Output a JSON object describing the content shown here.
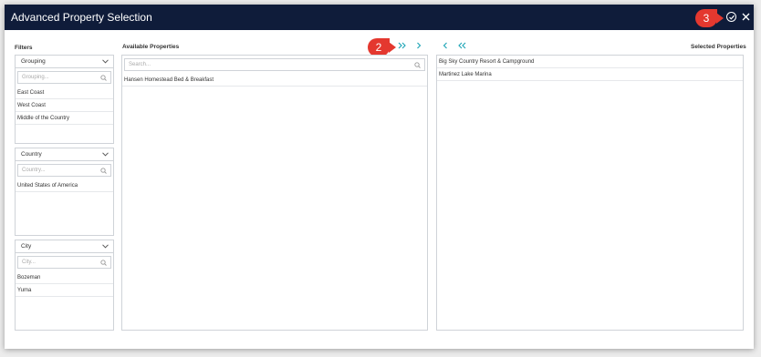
{
  "window": {
    "title": "Advanced Property Selection",
    "callout_confirm": "3"
  },
  "filters": {
    "label": "Filters",
    "grouping": {
      "header": "Grouping",
      "placeholder": "Grouping...",
      "items": [
        "East Coast",
        "West Coast",
        "Middle of the Country"
      ]
    },
    "country": {
      "header": "Country",
      "placeholder": "Country...",
      "items": [
        "United States of America"
      ]
    },
    "city": {
      "header": "City",
      "placeholder": "City...",
      "items": [
        "Bozeman",
        "Yuma"
      ]
    }
  },
  "available": {
    "label": "Available Properties",
    "search_placeholder": "Search...",
    "items": [
      "Hansen Homestead Bed & Breakfast"
    ],
    "callout_move": "2"
  },
  "selected": {
    "label": "Selected Properties",
    "items": [
      "Big Sky Country Resort & Campground",
      "Martinez Lake Marina"
    ]
  },
  "colors": {
    "titlebar": "#0f1c3a",
    "accent_arrows": "#1aa3b5",
    "callout": "#e4382f"
  },
  "icons": {
    "move_all_right": "double-chevron-right-icon",
    "move_right": "chevron-right-icon",
    "move_left": "chevron-left-icon",
    "move_all_left": "double-chevron-left-icon",
    "confirm": "check-circle-icon",
    "close": "close-icon"
  }
}
